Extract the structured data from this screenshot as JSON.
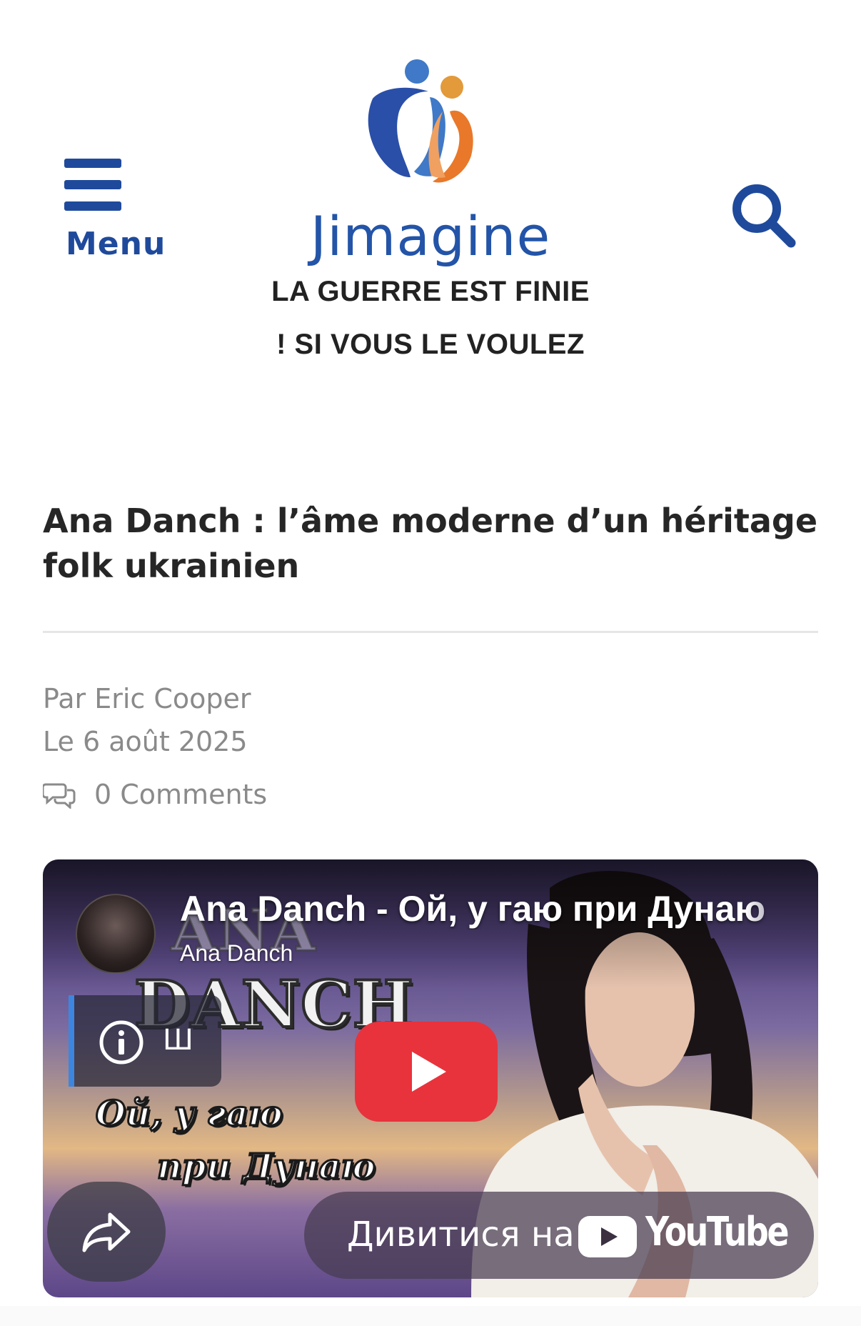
{
  "header": {
    "menu_label": "Menu",
    "brand_name": "Jimagine",
    "tagline_line1": "LA GUERRE EST FINIE",
    "tagline_line2": "! SI VOUS LE VOULEZ",
    "search_icon": "search-icon",
    "menu_icon": "hamburger-icon",
    "colors": {
      "brand_blue": "#2354a8",
      "brand_orange": "#e9782a",
      "logo_light_blue": "#3f79c7"
    }
  },
  "article": {
    "title": "Ana Danch : l’âme moderne d’un héritage folk ukrainien",
    "author": "Par Eric Cooper",
    "date": "Le 6 août 2025",
    "comments": "0 Comments",
    "comments_icon": "comments-icon"
  },
  "video": {
    "title": "Ana Danch - Ой, у гаю при Дунаю",
    "channel": "Ana Danch",
    "artist_text_1": "ANA",
    "artist_text_2": "DANCH",
    "info_label": "Ш",
    "song_line_1": "Ой, у гаю",
    "song_line_2": "при Дунаю",
    "watch_on": "Дивитися на",
    "youtube_word": "YouTube",
    "colors": {
      "play_red": "#e8333c",
      "info_accent": "#3d86e0"
    }
  }
}
